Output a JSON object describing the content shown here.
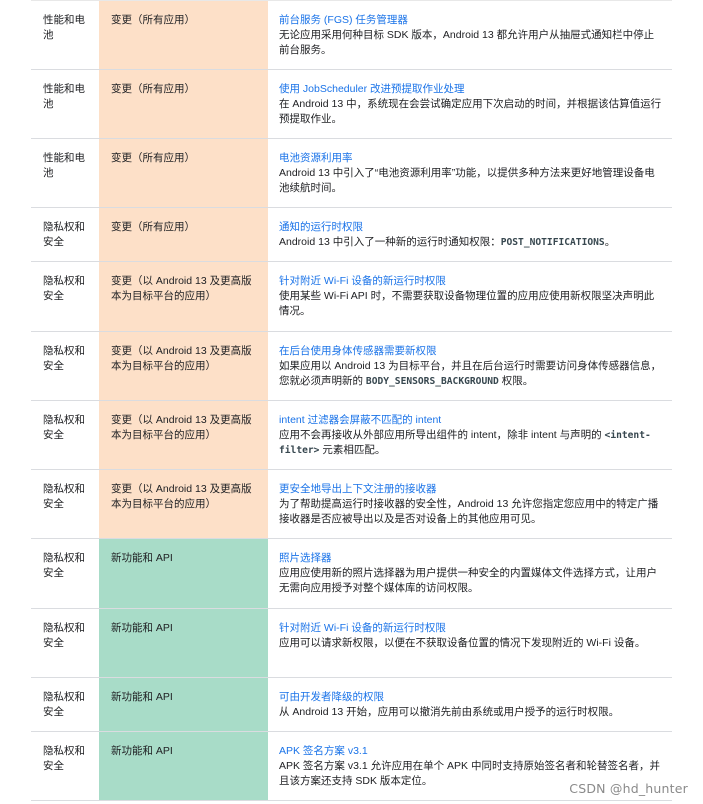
{
  "rows": [
    {
      "area": "性能和电池",
      "type": "变更（所有应用）",
      "kind": "change",
      "title": "前台服务 (FGS) 任务管理器",
      "desc": [
        "无论应用采用何种目标 SDK 版本，Android 13 都允许用户从抽屉式通知栏中停止前台服务。"
      ]
    },
    {
      "area": "性能和电池",
      "type": "变更（所有应用）",
      "kind": "change",
      "title": "使用 JobScheduler 改进预提取作业处理",
      "desc": [
        "在 Android 13 中，系统现在会尝试确定应用下次启动的时间，并根据该估算值运行预提取作业。"
      ]
    },
    {
      "area": "性能和电池",
      "type": "变更（所有应用）",
      "kind": "change",
      "title": "电池资源利用率",
      "desc": [
        "Android 13 中引入了“电池资源利用率”功能，以提供多种方法来更好地管理设备电池续航时间。"
      ]
    },
    {
      "area": "隐私权和安全",
      "type": "变更（所有应用）",
      "kind": "change",
      "title": "通知的运行时权限",
      "desc": [
        "Android 13 中引入了一种新的运行时通知权限：",
        {
          "code": "POST_NOTIFICATIONS"
        },
        "。"
      ]
    },
    {
      "area": "隐私权和安全",
      "type": "变更（以 Android 13 及更高版本为目标平台的应用）",
      "kind": "change",
      "title": "针对附近 Wi-Fi 设备的新运行时权限",
      "desc": [
        "使用某些 Wi-Fi API 时，不需要获取设备物理位置的应用应使用新权限坚决声明此情况。"
      ]
    },
    {
      "area": "隐私权和安全",
      "type": "变更（以 Android 13 及更高版本为目标平台的应用）",
      "kind": "change",
      "title": "在后台使用身体传感器需要新权限",
      "desc": [
        "如果应用以 Android 13 为目标平台，并且在后台运行时需要访问身体传感器信息，您就必须声明新的 ",
        {
          "code": "BODY_SENSORS_BACKGROUND"
        },
        " 权限。"
      ]
    },
    {
      "area": "隐私权和安全",
      "type": "变更（以 Android 13 及更高版本为目标平台的应用）",
      "kind": "change",
      "title": "intent 过滤器会屏蔽不匹配的 intent",
      "desc": [
        "应用不会再接收从外部应用所导出组件的 intent，除非 intent 与声明的 ",
        {
          "code": "<intent-filter>"
        },
        " 元素相匹配。"
      ]
    },
    {
      "area": "隐私权和安全",
      "type": "变更（以 Android 13 及更高版本为目标平台的应用）",
      "kind": "change",
      "title": "更安全地导出上下文注册的接收器",
      "desc": [
        "为了帮助提高运行时接收器的安全性，Android 13 允许您指定您应用中的特定广播接收器是否应被导出以及是否对设备上的其他应用可见。"
      ]
    },
    {
      "area": "隐私权和安全",
      "type": "新功能和 API",
      "kind": "feature",
      "title": "照片选择器",
      "desc": [
        "应用应使用新的照片选择器为用户提供一种安全的内置媒体文件选择方式，让用户无需向应用授予对整个媒体库的访问权限。"
      ]
    },
    {
      "area": "隐私权和安全",
      "type": "新功能和 API",
      "kind": "feature",
      "title": "针对附近 Wi-Fi 设备的新运行时权限",
      "desc": [
        "应用可以请求新权限，以便在不获取设备位置的情况下发现附近的 Wi-Fi 设备。"
      ]
    },
    {
      "area": "隐私权和安全",
      "type": "新功能和 API",
      "kind": "feature",
      "title": "可由开发者降级的权限",
      "desc": [
        "从 Android 13 开始，应用可以撤消先前由系统或用户授予的运行时权限。"
      ]
    },
    {
      "area": "隐私权和安全",
      "type": "新功能和 API",
      "kind": "feature",
      "title": "APK 签名方案 v3.1",
      "desc": [
        "APK 签名方案 v3.1 允许应用在单个 APK 中同时支持原始签名者和轮替签名者，并且该方案还支持 SDK 版本定位。"
      ]
    }
  ],
  "watermark": "CSDN @hd_hunter"
}
